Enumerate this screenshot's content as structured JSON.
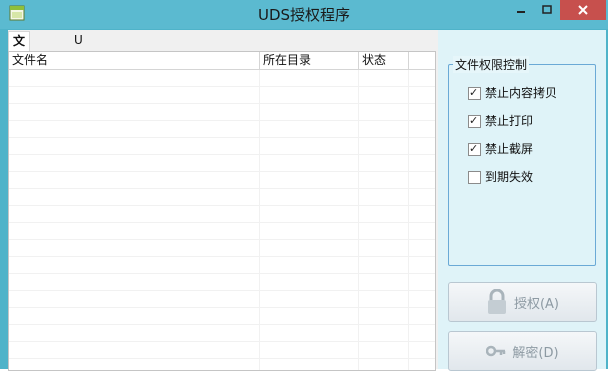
{
  "window": {
    "title": "UDS授权程序"
  },
  "tabs": [
    {
      "label": "文件控制",
      "active": true
    },
    {
      "label": "U盘控制",
      "active": false
    }
  ],
  "file_list": {
    "columns": [
      "文件名",
      "所在目录",
      "状态"
    ],
    "rows": []
  },
  "permissions": {
    "group_title": "文件权限控制",
    "options": [
      {
        "label": "禁止内容拷贝",
        "checked": true
      },
      {
        "label": "禁止打印",
        "checked": true
      },
      {
        "label": "禁止截屏",
        "checked": true
      },
      {
        "label": "到期失效",
        "checked": false
      }
    ]
  },
  "buttons": {
    "authorize_label": "授权(A)",
    "decrypt_label": "解密(D)"
  },
  "colors": {
    "titlebar": "#5bbad0",
    "close_button": "#c7504d",
    "group_border": "#6aa9d6"
  },
  "icons": [
    "app-icon",
    "minimize-icon",
    "maximize-icon",
    "close-icon",
    "lock-icon",
    "key-icon"
  ]
}
